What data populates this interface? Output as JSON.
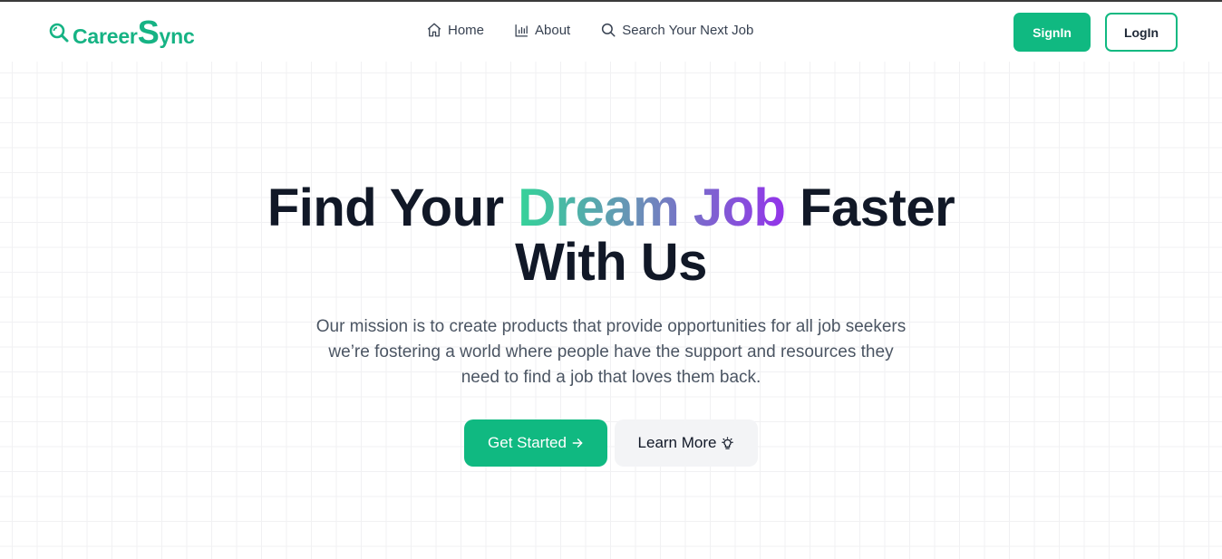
{
  "brand": {
    "name_prefix": "Career",
    "name_big": "S",
    "name_suffix": "ync",
    "color": "#16b384"
  },
  "nav": {
    "items": [
      {
        "label": "Home",
        "icon": "home-icon"
      },
      {
        "label": "About",
        "icon": "bar-chart-icon"
      },
      {
        "label": "Search Your Next Job",
        "icon": "search-icon"
      }
    ]
  },
  "auth": {
    "signin_label": "SignIn",
    "login_label": "LogIn"
  },
  "hero": {
    "headline_part1": "Find Your ",
    "headline_highlight": "Dream Job",
    "headline_part2": " Faster",
    "headline_line2": "With Us",
    "mission_line1": "Our mission is to create products that provide opportunities for all job seekers",
    "mission_line2": "we’re fostering a world where people have the support and resources they",
    "mission_line3": "need to find a job that loves them back.",
    "primary_cta": "Get Started",
    "secondary_cta": "Learn More"
  },
  "colors": {
    "accent": "#10b981",
    "heading": "#111827",
    "gradient_start": "#34d399",
    "gradient_end": "#9333ea"
  }
}
